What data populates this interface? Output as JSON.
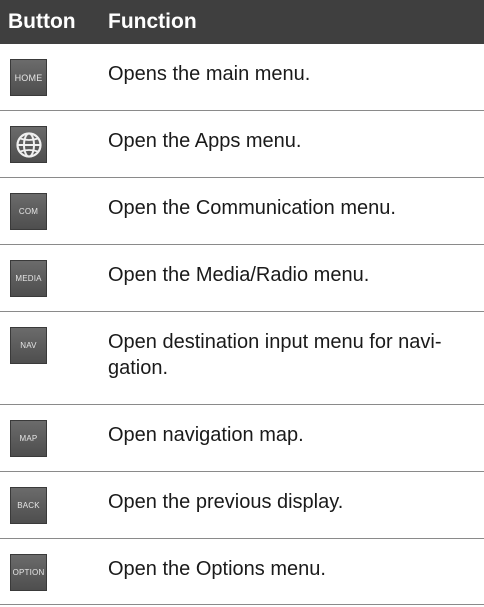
{
  "header": {
    "button_col": "Button",
    "function_col": "Function"
  },
  "rows": [
    {
      "icon": "home-button-icon",
      "button_label": "HOME",
      "description": "Opens the main menu."
    },
    {
      "icon": "globe-apps-icon",
      "button_label": "",
      "description": "Open the Apps menu."
    },
    {
      "icon": "com-button-icon",
      "button_label": "COM",
      "description": "Open the Communication menu."
    },
    {
      "icon": "media-button-icon",
      "button_label": "MEDIA",
      "description": "Open the Media/Radio menu."
    },
    {
      "icon": "nav-button-icon",
      "button_label": "NAV",
      "description": "Open destination input menu for navi-gation."
    },
    {
      "icon": "map-button-icon",
      "button_label": "MAP",
      "description": "Open navigation map."
    },
    {
      "icon": "back-button-icon",
      "button_label": "BACK",
      "description": "Open the previous display."
    },
    {
      "icon": "option-button-icon",
      "button_label": "OPTION",
      "description": "Open the Options menu."
    }
  ],
  "colors": {
    "header_bg": "#3f3f3f",
    "button_face": "#5a5a5a",
    "divider": "#8a8a8a"
  }
}
